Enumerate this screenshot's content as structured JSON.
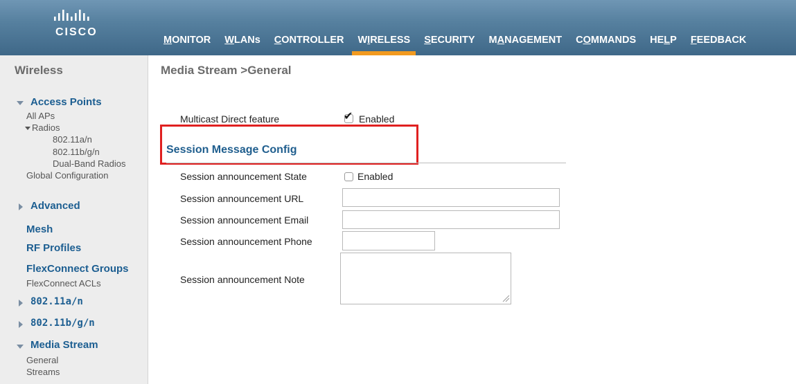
{
  "brand": {
    "logo_text": "CISCO",
    "header_color": "#4f7898",
    "accent_color": "#f29a1f"
  },
  "menu": {
    "items": [
      {
        "name": "monitor",
        "ul": "M",
        "rest": "ONITOR"
      },
      {
        "name": "wlans",
        "ul": "W",
        "rest": "LANs"
      },
      {
        "name": "controller",
        "ul": "C",
        "rest": "ONTROLLER"
      },
      {
        "name": "wireless",
        "ul": "W",
        "rest": "IRELESS",
        "pre": "",
        "active": true
      },
      {
        "name": "security",
        "ul": "S",
        "rest": "ECURITY"
      },
      {
        "name": "management",
        "ul": "M",
        "rest": "ANAGEMENT"
      },
      {
        "name": "commands",
        "ul": "C",
        "rest": "OMMANDS"
      },
      {
        "name": "help",
        "ul": "HELP",
        "rest": ""
      },
      {
        "name": "feedback",
        "ul": "F",
        "rest": "EEDBACK"
      }
    ],
    "labels": [
      "MONITOR",
      "WLANs",
      "CONTROLLER",
      "WIRELESS",
      "SECURITY",
      "MANAGEMENT",
      "COMMANDS",
      "HELP",
      "FEEDBACK"
    ],
    "active": "WIRELESS"
  },
  "sidebar": {
    "title": "Wireless",
    "access_points": "Access Points",
    "all_aps": "All APs",
    "radios": "Radios",
    "radio_80211an": "802.11a/n",
    "radio_80211bgn": "802.11b/g/n",
    "dual_band": "Dual-Band Radios",
    "global_config": "Global Configuration",
    "advanced": "Advanced",
    "mesh": "Mesh",
    "rf_profiles": "RF Profiles",
    "flexconnect_groups": "FlexConnect Groups",
    "flexconnect_acls": "FlexConnect ACLs",
    "an": "802.11a/n",
    "bgn": "802.11b/g/n",
    "media_stream": "Media Stream",
    "general": "General",
    "streams": "Streams"
  },
  "main": {
    "page_title": "Media Stream >General",
    "multicast_label": "Multicast Direct feature",
    "multicast_enabled_text": "Enabled",
    "multicast_checked": true,
    "section_title": "Session Message Config",
    "state_label": "Session announcement State",
    "state_enabled_text": "Enabled",
    "state_checked": false,
    "url_label": "Session announcement URL",
    "url_value": "",
    "email_label": "Session announcement Email",
    "email_value": "",
    "phone_label": "Session announcement Phone",
    "phone_value": "",
    "note_label": "Session announcement Note",
    "note_value": "",
    "highlight_color": "#e02020"
  }
}
